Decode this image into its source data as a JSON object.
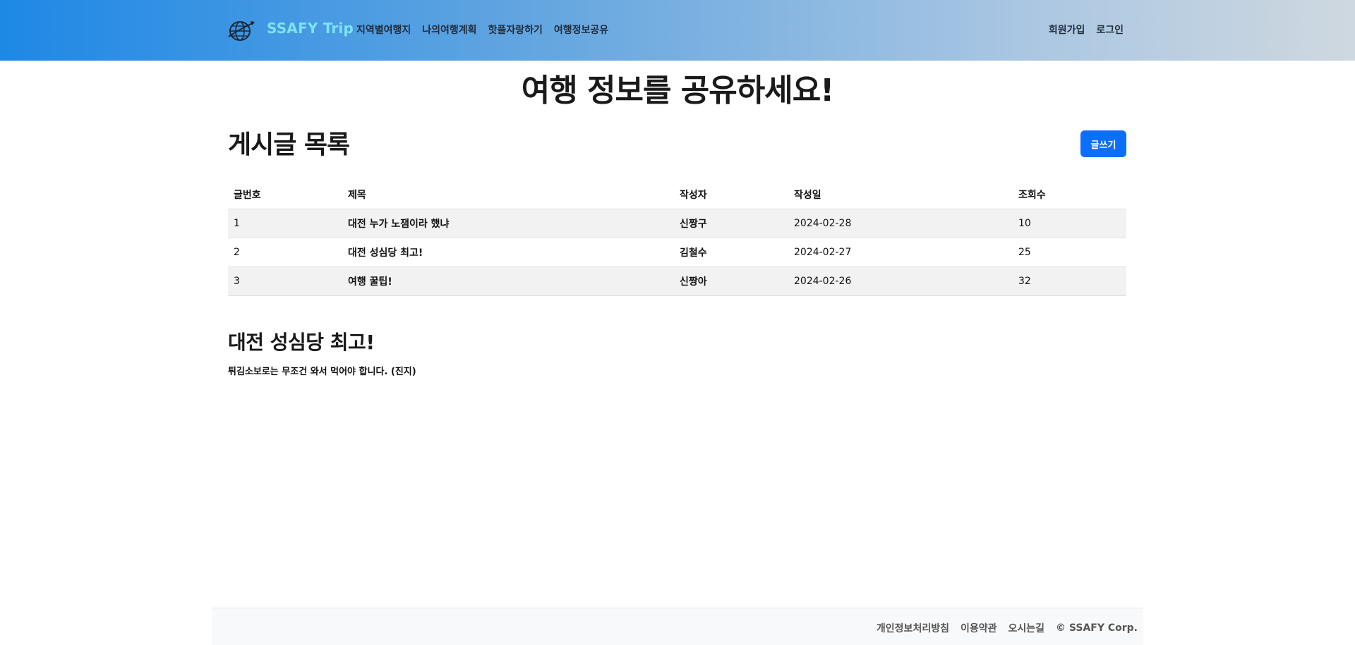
{
  "nav": {
    "brand": "SSAFY Trip",
    "links": [
      "지역별여행지",
      "나의여행계획",
      "핫플자랑하기",
      "여행정보공유"
    ],
    "right": [
      "회원가입",
      "로그인"
    ],
    "brand_color": "#7ee3f0"
  },
  "hero": {
    "title": "여행 정보를 공유하세요!"
  },
  "board": {
    "title": "게시글 목록",
    "write_label": "글쓰기",
    "columns": [
      "글번호",
      "제목",
      "작성자",
      "작성일",
      "조회수"
    ],
    "rows": [
      {
        "no": "1",
        "title": "대전 누가 노잼이라 했냐",
        "author": "신짱구",
        "date": "2024-02-28",
        "views": "10"
      },
      {
        "no": "2",
        "title": "대전 성심당 최고!",
        "author": "김철수",
        "date": "2024-02-27",
        "views": "25"
      },
      {
        "no": "3",
        "title": "여행 꿀팁!",
        "author": "신짱아",
        "date": "2024-02-26",
        "views": "32"
      }
    ]
  },
  "detail": {
    "title": "대전 성심당 최고!",
    "content": "튀김소보로는 무조건 와서 먹어야 합니다. (진지)"
  },
  "footer": {
    "links": [
      "개인정보처리방침",
      "이용약관",
      "오시는길"
    ],
    "copyright": "© SSAFY Corp."
  },
  "colors": {
    "primary": "#0d6efd",
    "stripe": "#f2f2f2"
  },
  "icons": {
    "logo": "globe-airplane-icon"
  }
}
